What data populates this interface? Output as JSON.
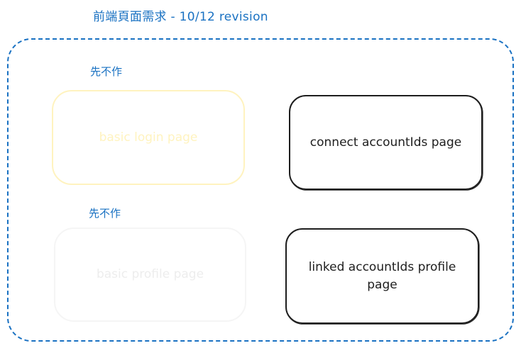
{
  "title": "前端頁面需求 - 10/12 revision",
  "notes": [
    "先不作",
    "先不作"
  ],
  "boxes": {
    "login": "basic login page",
    "profile": "basic profile page",
    "connect": "connect accountIds page",
    "linked": "linked accountIds profile page"
  },
  "colors": {
    "accent": "#1971c2",
    "stroke": "#1e1e1e",
    "faded_yellow": "#fff3bf",
    "faded_gray": "#f5f5f5"
  }
}
